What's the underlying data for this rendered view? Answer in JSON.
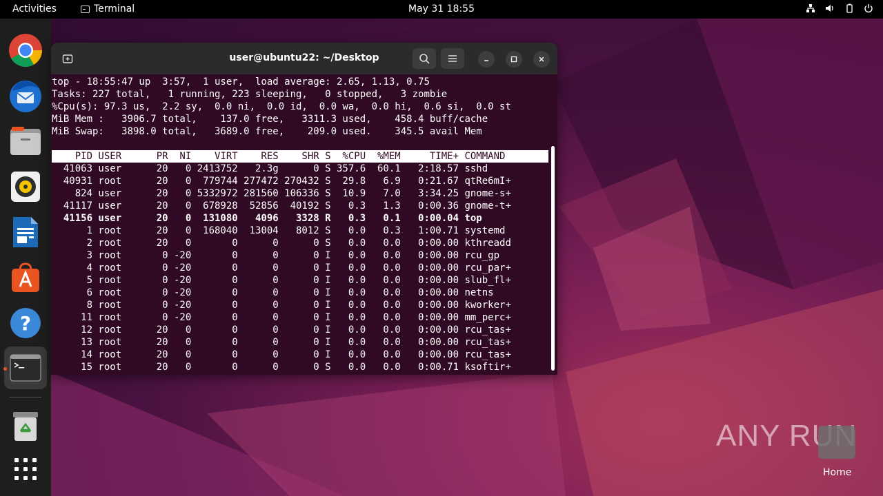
{
  "topbar": {
    "activities": "Activities",
    "app_name": "Terminal",
    "datetime": "May 31  18:55",
    "tray_icons": [
      "network-icon",
      "volume-icon",
      "battery-icon",
      "power-icon"
    ]
  },
  "dock": {
    "items": [
      "chrome",
      "thunderbird",
      "files",
      "rhythmbox",
      "libreoffice-writer",
      "app-center",
      "help",
      "terminal",
      "trash",
      "show-apps"
    ]
  },
  "terminal": {
    "title": "user@ubuntu22: ~/Desktop",
    "summary": [
      "top - 18:55:47 up  3:57,  1 user,  load average: 2.65, 1.13, 0.75",
      "Tasks: 227 total,   1 running, 223 sleeping,   0 stopped,   3 zombie",
      "%Cpu(s): 97.3 us,  2.2 sy,  0.0 ni,  0.0 id,  0.0 wa,  0.0 hi,  0.6 si,  0.0 st",
      "MiB Mem :   3906.7 total,    137.0 free,   3311.3 used,    458.4 buff/cache",
      "MiB Swap:   3898.0 total,   3689.0 free,    209.0 used.    345.5 avail Mem"
    ],
    "header": "    PID USER      PR  NI    VIRT    RES    SHR S  %CPU  %MEM     TIME+ COMMAND ",
    "processes": [
      "  41063 user      20   0 2413752   2.3g      0 S 357.6  60.1   2:18.57 sshd",
      "  40931 root      20   0  779744 277472 270432 S  29.8   6.9   0:21.67 qtRe6mI+",
      "    824 user      20   0 5332972 281560 106336 S  10.9   7.0   3:34.25 gnome-s+",
      "  41117 user      20   0  678928  52856  40192 S   0.3   1.3   0:00.36 gnome-t+",
      "  41156 user      20   0  131080   4096   3328 R   0.3   0.1   0:00.04 top",
      "      1 root      20   0  168040  13004   8012 S   0.0   0.3   1:00.71 systemd",
      "      2 root      20   0       0      0      0 S   0.0   0.0   0:00.00 kthreadd",
      "      3 root       0 -20       0      0      0 I   0.0   0.0   0:00.00 rcu_gp",
      "      4 root       0 -20       0      0      0 I   0.0   0.0   0:00.00 rcu_par+",
      "      5 root       0 -20       0      0      0 I   0.0   0.0   0:00.00 slub_fl+",
      "      6 root       0 -20       0      0      0 I   0.0   0.0   0:00.00 netns",
      "      8 root       0 -20       0      0      0 I   0.0   0.0   0:00.00 kworker+",
      "     11 root       0 -20       0      0      0 I   0.0   0.0   0:00.00 mm_perc+",
      "     12 root      20   0       0      0      0 I   0.0   0.0   0:00.00 rcu_tas+",
      "     13 root      20   0       0      0      0 I   0.0   0.0   0:00.00 rcu_tas+",
      "     14 root      20   0       0      0      0 I   0.0   0.0   0:00.00 rcu_tas+",
      "     15 root      20   0       0      0      0 S   0.0   0.0   0:00.71 ksoftir+"
    ]
  },
  "desktop": {
    "watermark": "ANY RUN",
    "home_label": "Home"
  }
}
